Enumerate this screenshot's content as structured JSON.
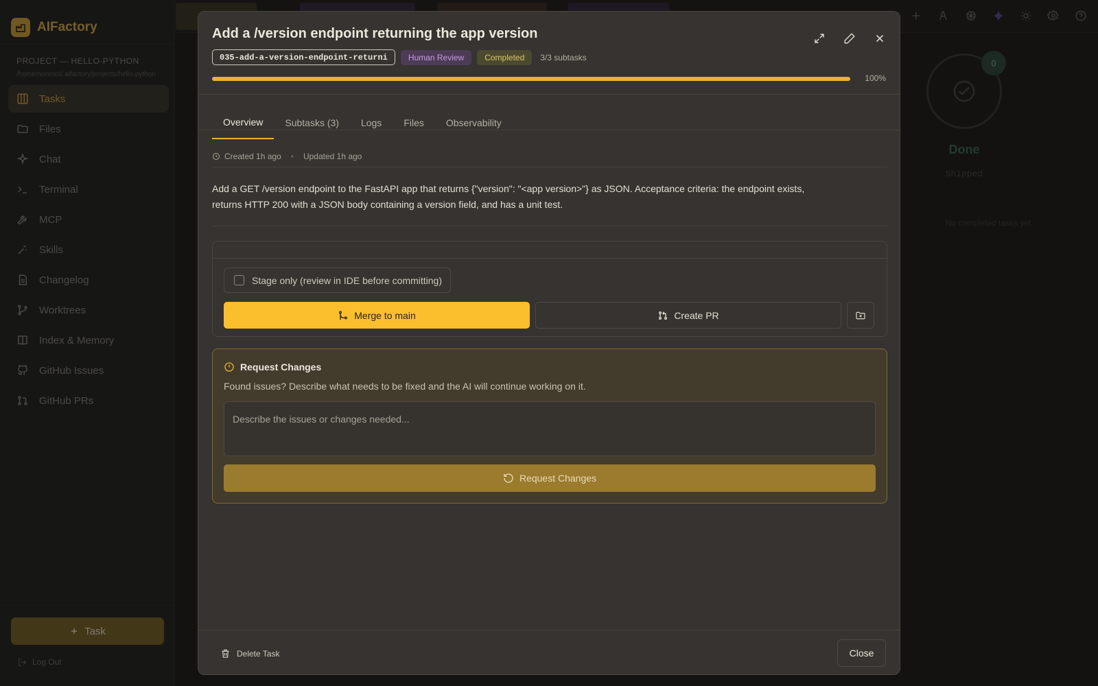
{
  "app": {
    "name": "AIFactory",
    "logo_icon": "factory-icon",
    "accent": "#fbbf2e"
  },
  "sidebar": {
    "project_title": "PROJECT — HELLO-PYTHON",
    "project_path": "/home/nonroot/.aifactory/projects/hello-python",
    "items": [
      {
        "label": "Tasks",
        "icon": "columns-icon",
        "active": true
      },
      {
        "label": "Files",
        "icon": "folder-icon"
      },
      {
        "label": "Chat",
        "icon": "sparkles-icon"
      },
      {
        "label": "Terminal",
        "icon": "terminal-icon"
      },
      {
        "label": "MCP",
        "icon": "wrench-icon"
      },
      {
        "label": "Skills",
        "icon": "sparkle-wand-icon"
      },
      {
        "label": "Changelog",
        "icon": "document-icon"
      },
      {
        "label": "Worktrees",
        "icon": "git-branch-icon"
      },
      {
        "label": "Index & Memory",
        "icon": "book-icon"
      },
      {
        "label": "GitHub Issues",
        "icon": "github-icon"
      },
      {
        "label": "GitHub PRs",
        "icon": "git-pull-request-icon"
      }
    ],
    "new_task_label": "Task",
    "logout_label": "Log Out"
  },
  "board": {
    "done_column": {
      "count": "0",
      "title": "Done",
      "subtitle": "Shipped",
      "empty_text": "No completed tasks yet"
    }
  },
  "modal": {
    "title": "Add a /version endpoint returning the app version",
    "task_id": "035-add-a-version-endpoint-returni",
    "status_badges": [
      "Human Review",
      "Completed"
    ],
    "subtasks_summary": "3/3 subtasks",
    "progress": 100,
    "progress_label": "100%",
    "tabs": [
      "Overview",
      "Subtasks (3)",
      "Logs",
      "Files",
      "Observability"
    ],
    "active_tab": "Overview",
    "created": "Created 1h ago",
    "updated": "Updated 1h ago",
    "description": "Add a GET /version endpoint to the FastAPI app that returns {\"version\": \"<app version>\"} as JSON. Acceptance criteria: the endpoint exists, returns HTTP 200 with a JSON body containing a version field, and has a unit test.",
    "stage_only_label": "Stage only (review in IDE before committing)",
    "stage_only_checked": false,
    "merge_label": "Merge to main",
    "create_pr_label": "Create PR",
    "request_changes": {
      "title": "Request Changes",
      "description": "Found issues? Describe what needs to be fixed and the AI will continue working on it.",
      "placeholder": "Describe the issues or changes needed...",
      "value": "",
      "button_label": "Request Changes"
    },
    "delete_label": "Delete Task",
    "close_label": "Close"
  }
}
